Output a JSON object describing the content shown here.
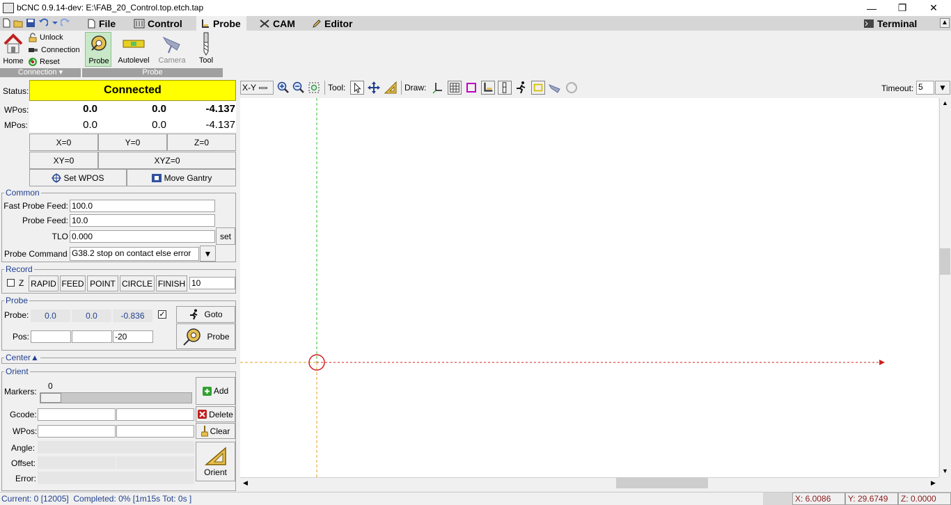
{
  "window": {
    "title": "bCNC 0.9.14-dev: E:\\FAB_20_Control.top.etch.tap"
  },
  "menu": {
    "file": "File",
    "control": "Control",
    "probe": "Probe",
    "cam": "CAM",
    "editor": "Editor",
    "terminal": "Terminal"
  },
  "ribbon": {
    "home": "Home",
    "unlock": "Unlock",
    "connection": "Connection",
    "reset": "Reset",
    "connection_group": "Connection",
    "probe": "Probe",
    "autolevel": "Autolevel",
    "camera": "Camera",
    "tool": "Tool",
    "probe_group": "Probe"
  },
  "dro": {
    "status_label": "Status:",
    "status": "Connected",
    "wpos_label": "WPos:",
    "mpos_label": "MPos:",
    "wpos": {
      "x": "0.0",
      "y": "0.0",
      "z": "-4.137"
    },
    "mpos": {
      "x": "0.0",
      "y": "0.0",
      "z": "-4.137"
    },
    "x0": "X=0",
    "y0": "Y=0",
    "z0": "Z=0",
    "xy0": "XY=0",
    "xyz0": "XYZ=0",
    "set_wpos": "Set WPOS",
    "move_gantry": "Move Gantry"
  },
  "common": {
    "title": "Common",
    "fast_feed_label": "Fast Probe Feed:",
    "fast_feed": "100.0",
    "probe_feed_label": "Probe Feed:",
    "probe_feed": "10.0",
    "tlo_label": "TLO",
    "tlo": "0.000",
    "set": "set",
    "cmd_label": "Probe Command",
    "cmd": "G38.2 stop on contact else error"
  },
  "record": {
    "title": "Record",
    "z": "Z",
    "rapid": "RAPID",
    "feed": "FEED",
    "point": "POINT",
    "circle": "CIRCLE",
    "finish": "FINISH",
    "value": "10"
  },
  "probe": {
    "title": "Probe",
    "probe_label": "Probe:",
    "x": "0.0",
    "y": "0.0",
    "z": "-0.836",
    "goto": "Goto",
    "pos_label": "Pos:",
    "pos_z": "-20",
    "probe_btn": "Probe"
  },
  "center": {
    "title": "Center▲"
  },
  "orient": {
    "title": "Orient",
    "markers_label": "Markers:",
    "markers_value": "0",
    "add": "Add",
    "gcode_label": "Gcode:",
    "delete": "Delete",
    "wpos_label": "WPos:",
    "clear": "Clear",
    "angle_label": "Angle:",
    "offset_label": "Offset:",
    "error_label": "Error:",
    "orient_btn": "Orient"
  },
  "canvas_toolbar": {
    "view": "X-Y",
    "tool_label": "Tool:",
    "draw_label": "Draw:",
    "timeout_label": "Timeout:",
    "timeout": "5"
  },
  "statusbar": {
    "text": "Current: 0 [12005]  Completed: 0% [1m15s Tot: 0s ]",
    "x": "X: 6.0086",
    "y": "Y: 29.6749",
    "z": "Z: 0.0000"
  },
  "colors": {
    "status_bg": "#ffff00",
    "accent": "#1f3f8f",
    "coord": "#8b1a1a"
  }
}
